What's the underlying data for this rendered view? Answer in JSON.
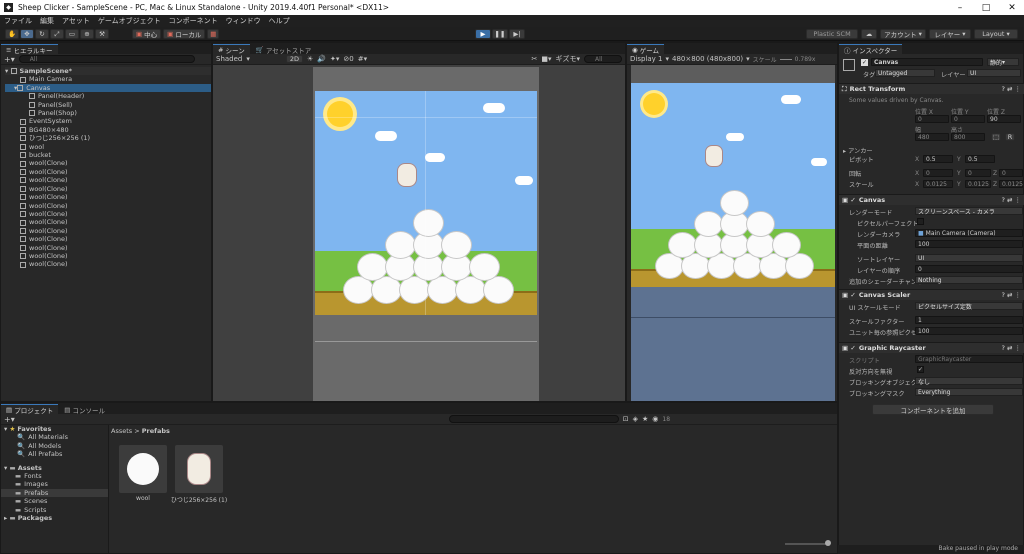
{
  "window": {
    "title": "Sheep Clicker - SampleScene - PC, Mac & Linux Standalone - Unity 2019.4.40f1 Personal* <DX11>"
  },
  "menu": [
    "ファイル",
    "編集",
    "アセット",
    "ゲームオブジェクト",
    "コンポーネント",
    "ウィンドウ",
    "ヘルプ"
  ],
  "toolbar": {
    "pivot": "中心",
    "space": "ローカル",
    "plastic": "Plastic SCM",
    "account": "アカウント",
    "layers": "レイヤー",
    "layout": "Layout"
  },
  "hierarchy": {
    "tab": "ヒエラルキー",
    "search": "All",
    "scene": "SampleScene*",
    "items": [
      "Main Camera",
      "Canvas",
      "Panel(Header)",
      "Panel(Sell)",
      "Panel(Shop)",
      "EventSystem",
      "BG480×480",
      "ひつじ256×256 (1)",
      "wool",
      "bucket",
      "wool(Clone)",
      "wool(Clone)",
      "wool(Clone)",
      "wool(Clone)",
      "wool(Clone)",
      "wool(Clone)",
      "wool(Clone)",
      "wool(Clone)",
      "wool(Clone)",
      "wool(Clone)",
      "wool(Clone)",
      "wool(Clone)",
      "wool(Clone)"
    ]
  },
  "scene": {
    "tab": "シーン",
    "tab2": "アセットストア",
    "shading": "Shaded",
    "mode2d": "2D",
    "gizmos": "ギズモ",
    "all": "All",
    "counter": "0"
  },
  "game": {
    "tab": "ゲーム",
    "display": "Display 1",
    "resolution": "480×800 (480x800)",
    "scale_label": "スケール",
    "scale": "0.789x"
  },
  "inspector": {
    "tab": "インスペクター",
    "name": "Canvas",
    "static": "静的",
    "tag_label": "タグ",
    "tag": "Untagged",
    "layer_label": "レイヤー",
    "layer": "UI",
    "rect": {
      "title": "Rect Transform",
      "note": "Some values driven by Canvas.",
      "pos_x_label": "位置 X",
      "pos_y_label": "位置 Y",
      "pos_z_label": "位置 Z",
      "width_label": "幅",
      "height_label": "高さ",
      "pos_x": "0",
      "pos_y": "0",
      "pos_z": "90",
      "width": "480",
      "height": "800",
      "anchor": "アンカー",
      "pivot": "ピボット",
      "pivot_x": "0.5",
      "pivot_y": "0.5",
      "rotation": "回転",
      "rot_x": "0",
      "rot_y": "0",
      "rot_z": "0",
      "scale": "スケール",
      "sc_x": "0.0125",
      "sc_y": "0.0125",
      "sc_z": "0.0125"
    },
    "canvas": {
      "title": "Canvas",
      "render_mode_label": "レンダーモード",
      "render_mode": "スクリーンスペース - カメラ",
      "pixel_perfect": "ピクセルパーフェクト",
      "render_camera_label": "レンダーカメラ",
      "render_camera": "Main Camera (Camera)",
      "plane_label": "平面の距離",
      "plane": "100",
      "sort_layer_label": "ソートレイヤー",
      "sort_layer": "UI",
      "order_label": "レイヤーの順序",
      "order": "0",
      "shader_label": "追加のシェーダーチャンネル",
      "shader": "Nothing"
    },
    "scaler": {
      "title": "Canvas Scaler",
      "mode_label": "UI スケールモード",
      "mode": "ピクセルサイズ定数",
      "factor_label": "スケールファクター",
      "factor": "1",
      "ppu_label": "ユニット毎の参照ピクセル",
      "ppu": "100"
    },
    "raycaster": {
      "title": "Graphic Raycaster",
      "script_label": "スクリプト",
      "script": "GraphicRaycaster",
      "reversed_label": "反対方向を無視",
      "blocking_label": "ブロッキングオブジェクト",
      "blocking": "なし",
      "mask_label": "ブロッキングマスク",
      "mask": "Everything"
    },
    "add_component": "コンポーネントを追加"
  },
  "project": {
    "tab": "プロジェクト",
    "tab2": "コンソール",
    "favorites": "Favorites",
    "fav_items": [
      "All Materials",
      "All Models",
      "All Prefabs"
    ],
    "assets": "Assets",
    "asset_folders": [
      "Fonts",
      "Images",
      "Prefabs",
      "Scenes",
      "Scripts"
    ],
    "packages": "Packages",
    "breadcrumb_root": "Assets",
    "breadcrumb_leaf": "Prefabs",
    "count": "18",
    "prefabs": [
      "wool",
      "ひつじ256×256 (1)"
    ]
  },
  "status": {
    "text": "Bake paused in play mode"
  }
}
